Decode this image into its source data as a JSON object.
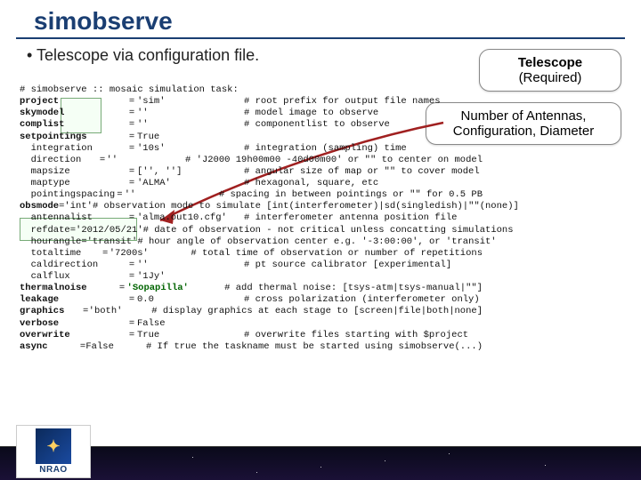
{
  "title": "simobserve",
  "bullet": "Telescope via configuration file.",
  "callout1": {
    "line1": "Telescope",
    "line2": "(Required)"
  },
  "callout2": {
    "line1": "Number of Antennas,",
    "line2": "Configuration, Diameter"
  },
  "header": "# simobserve :: mosaic simulation task:",
  "rows": [
    {
      "k": "project",
      "v": "'sim'",
      "c": "# root prefix for output file names"
    },
    {
      "k": "skymodel",
      "v": "''",
      "c": "# model image to observe"
    },
    {
      "k": "complist",
      "v": "''",
      "c": "# componentlist to observe"
    },
    {
      "k": "setpointings",
      "v": "True",
      "c": ""
    },
    {
      "k": "  integration",
      "v": "'10s'",
      "c": "# integration (sampling) time"
    },
    {
      "k": "  direction",
      "v": "''",
      "c": "# 'J2000 19h00m00 -40d00m00' or \"\" to center on model"
    },
    {
      "k": "  mapsize",
      "v": "['', '']",
      "c": "# angular size of map or \"\" to cover model"
    },
    {
      "k": "  maptype",
      "v": "'ALMA'",
      "c": "# hexagonal, square, etc"
    },
    {
      "k": "  pointingspacing",
      "v": "''",
      "c": "# spacing in between pointings or \"\" for 0.5 PB"
    },
    {
      "k": "",
      "v": "",
      "c": ""
    },
    {
      "k": "obsmode",
      "v": "'int'",
      "c": "# observation mode to simulate [int(interferometer)|sd(singledish)|\"\"(none)]"
    },
    {
      "k": "  antennalist",
      "v": "'alma.out10.cfg'",
      "c": "# interferometer antenna position file"
    },
    {
      "k": "  refdate",
      "v": "'2012/05/21'",
      "c": "# date of observation - not critical unless concatting simulations"
    },
    {
      "k": "  hourangle",
      "v": "'transit'",
      "c": "# hour angle of observation center e.g. '-3:00:00', or 'transit'"
    },
    {
      "k": "  totaltime",
      "v": "'7200s'",
      "c": "# total time of observation or number of repetitions"
    },
    {
      "k": "  caldirection",
      "v": "''",
      "c": "# pt source calibrator [experimental]"
    },
    {
      "k": "  calflux",
      "v": "'1Jy'",
      "c": ""
    },
    {
      "k": "",
      "v": "",
      "c": ""
    },
    {
      "k": "thermalnoise",
      "v": "__SOPA__",
      "c": "# add thermal noise: [tsys-atm|tsys-manual|\"\"]"
    },
    {
      "k": "leakage",
      "v": "0.0",
      "c": "# cross polarization (interferometer only)"
    },
    {
      "k": "graphics",
      "v": "'both'",
      "c": "# display graphics at each stage to [screen|file|both|none]"
    },
    {
      "k": "verbose",
      "v": "False",
      "c": ""
    },
    {
      "k": "overwrite",
      "v": "True",
      "c": "# overwrite files starting with $project"
    },
    {
      "k": "async",
      "v": "False",
      "c": "# If true the taskname must be started using simobserve(...)"
    }
  ],
  "sopa": "'Sopapilla'",
  "bold_keys": [
    "project",
    "skymodel",
    "complist",
    "setpointings",
    "obsmode",
    "thermalnoise",
    "leakage",
    "graphics",
    "verbose",
    "overwrite",
    "async"
  ],
  "logo_text": "NRAO",
  "logo_glyph": "✦"
}
